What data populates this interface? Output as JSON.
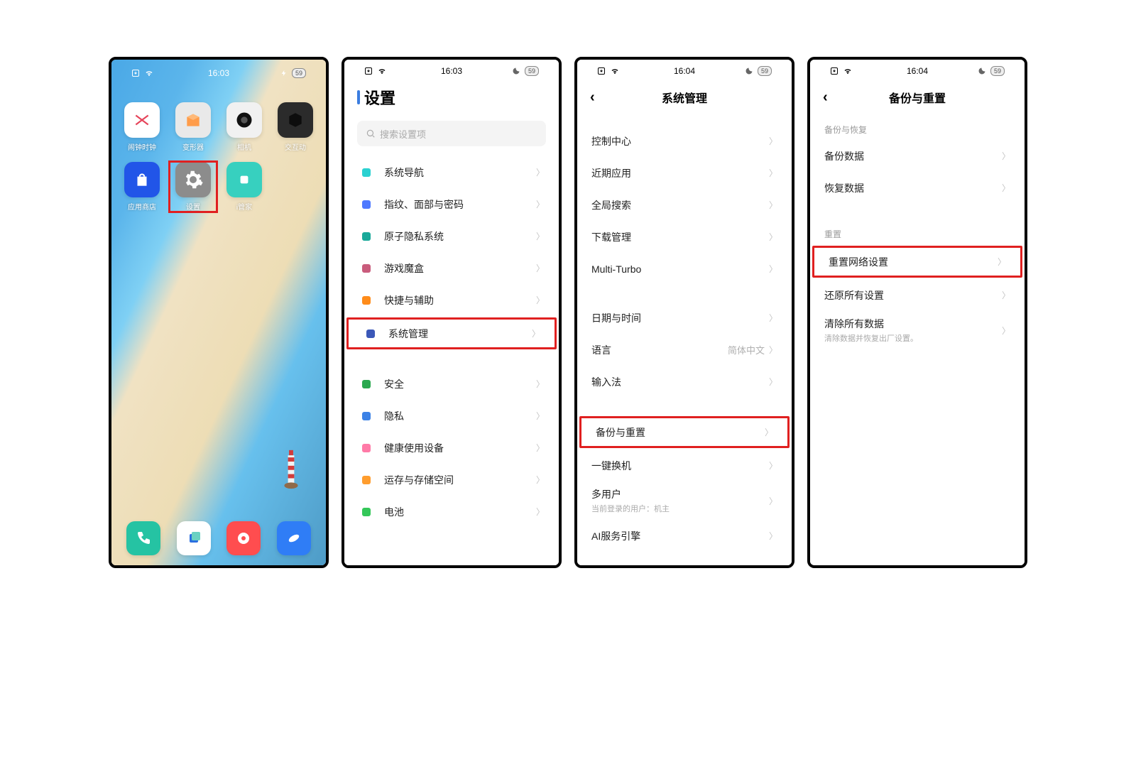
{
  "screen1": {
    "time": "16:03",
    "battery": "59",
    "apps": [
      {
        "label": "闹钟时钟",
        "bg": "#ffffff",
        "fg": "#e6445a"
      },
      {
        "label": "变形器",
        "bg": "#e9e9e9",
        "fg": "#d0914d"
      },
      {
        "label": "相机",
        "bg": "#f1f1f1",
        "fg": "#111"
      },
      {
        "label": "交互动",
        "bg": "#2b2b2b",
        "fg": "#0a0a0a"
      },
      {
        "label": "应用商店",
        "bg": "#2155e8",
        "fg": "#fff"
      },
      {
        "label": "设置",
        "bg": "#8c8c8c",
        "fg": "#fff",
        "highlight": true
      },
      {
        "label": "i管家",
        "bg": "#37d0bf",
        "fg": "#fff"
      }
    ],
    "dock": [
      {
        "bg": "#25c3a3",
        "fg": "#fff",
        "name": "phone"
      },
      {
        "bg": "#ffffff",
        "fg": "#2a6fe0",
        "name": "messages"
      },
      {
        "bg": "#ff4d4f",
        "fg": "#fff",
        "name": "music"
      },
      {
        "bg": "#2f7df6",
        "fg": "#fff",
        "name": "browser"
      }
    ]
  },
  "screen2": {
    "time": "16:03",
    "battery": "59",
    "title": "设置",
    "search_placeholder": "搜索设置项",
    "rows_group1": [
      {
        "label": "系统导航",
        "iconClass": "i-cyan",
        "iconName": "nav-icon"
      },
      {
        "label": "指纹、面部与密码",
        "iconClass": "i-blue",
        "iconName": "fingerprint-icon"
      },
      {
        "label": "原子隐私系统",
        "iconClass": "i-teal",
        "iconName": "atom-privacy-icon"
      },
      {
        "label": "游戏魔盒",
        "iconClass": "i-game",
        "iconName": "game-icon"
      },
      {
        "label": "快捷与辅助",
        "iconClass": "i-orange",
        "iconName": "shortcut-icon"
      },
      {
        "label": "系统管理",
        "iconClass": "i-navy",
        "iconName": "system-icon",
        "highlight": true
      }
    ],
    "rows_group2": [
      {
        "label": "安全",
        "iconClass": "i-green",
        "iconName": "shield-icon"
      },
      {
        "label": "隐私",
        "iconClass": "i-lock",
        "iconName": "lock-icon"
      },
      {
        "label": "健康使用设备",
        "iconClass": "i-health",
        "iconName": "health-icon"
      },
      {
        "label": "运存与存储空间",
        "iconClass": "i-storage",
        "iconName": "storage-icon"
      },
      {
        "label": "电池",
        "iconClass": "i-batt",
        "iconName": "battery-icon"
      }
    ]
  },
  "screen3": {
    "time": "16:04",
    "battery": "59",
    "title": "系统管理",
    "rows_group1": [
      {
        "label": "控制中心"
      },
      {
        "label": "近期应用"
      },
      {
        "label": "全局搜索"
      },
      {
        "label": "下载管理"
      },
      {
        "label": "Multi-Turbo"
      }
    ],
    "rows_group2": [
      {
        "label": "日期与时间"
      },
      {
        "label": "语言",
        "value": "简体中文"
      },
      {
        "label": "输入法"
      }
    ],
    "rows_group3": [
      {
        "label": "备份与重置",
        "highlight": true
      },
      {
        "label": "一键换机"
      },
      {
        "label": "多用户",
        "sub": "当前登录的用户：机主"
      },
      {
        "label": "AI服务引擎"
      }
    ]
  },
  "screen4": {
    "time": "16:04",
    "battery": "59",
    "title": "备份与重置",
    "section1_label": "备份与恢复",
    "rows_group1": [
      {
        "label": "备份数据"
      },
      {
        "label": "恢复数据"
      }
    ],
    "section2_label": "重置",
    "rows_group2": [
      {
        "label": "重置网络设置",
        "highlight": true
      },
      {
        "label": "还原所有设置"
      },
      {
        "label": "清除所有数据",
        "sub": "清除数据并恢复出厂设置。"
      }
    ]
  }
}
